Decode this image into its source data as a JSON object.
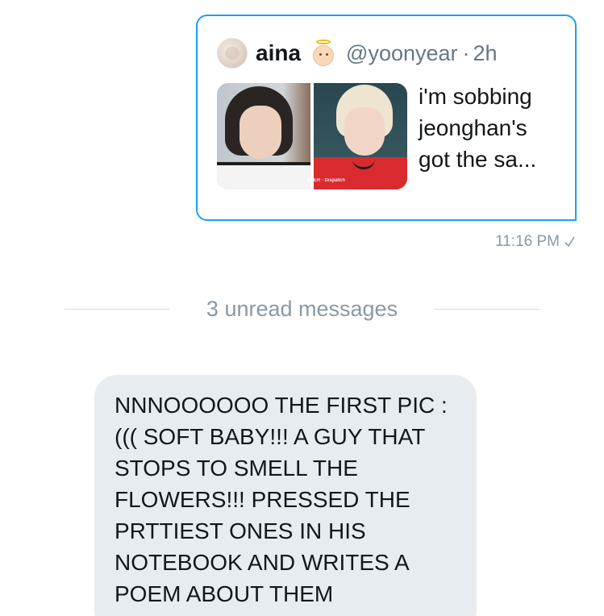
{
  "sent_message": {
    "quote": {
      "author_name": "aina",
      "handle": "@yoonyear",
      "separator": "·",
      "time_ago": "2h",
      "text": "i'm sobbing\njeonghan's\ngot the sa...",
      "media_watermark": "AVER · Dispatch"
    },
    "timestamp": "11:16 PM",
    "status_icon": "check-icon"
  },
  "unread_divider": {
    "label": "3 unread messages"
  },
  "received_message": {
    "text": "NNNOOOOOO THE FIRST PIC :\n((( SOFT BABY!!! A GUY THAT\nSTOPS TO SMELL THE\nFLOWERS!!! PRESSED THE\nPRTTIEST ONES IN HIS\nNOTEBOOK AND WRITES A\nPOEM ABOUT THEM"
  },
  "colors": {
    "accent": "#1da1f2",
    "secondary_text": "#657786",
    "meta_text": "#8899a6",
    "bubble_bg": "#e6ecf0"
  }
}
